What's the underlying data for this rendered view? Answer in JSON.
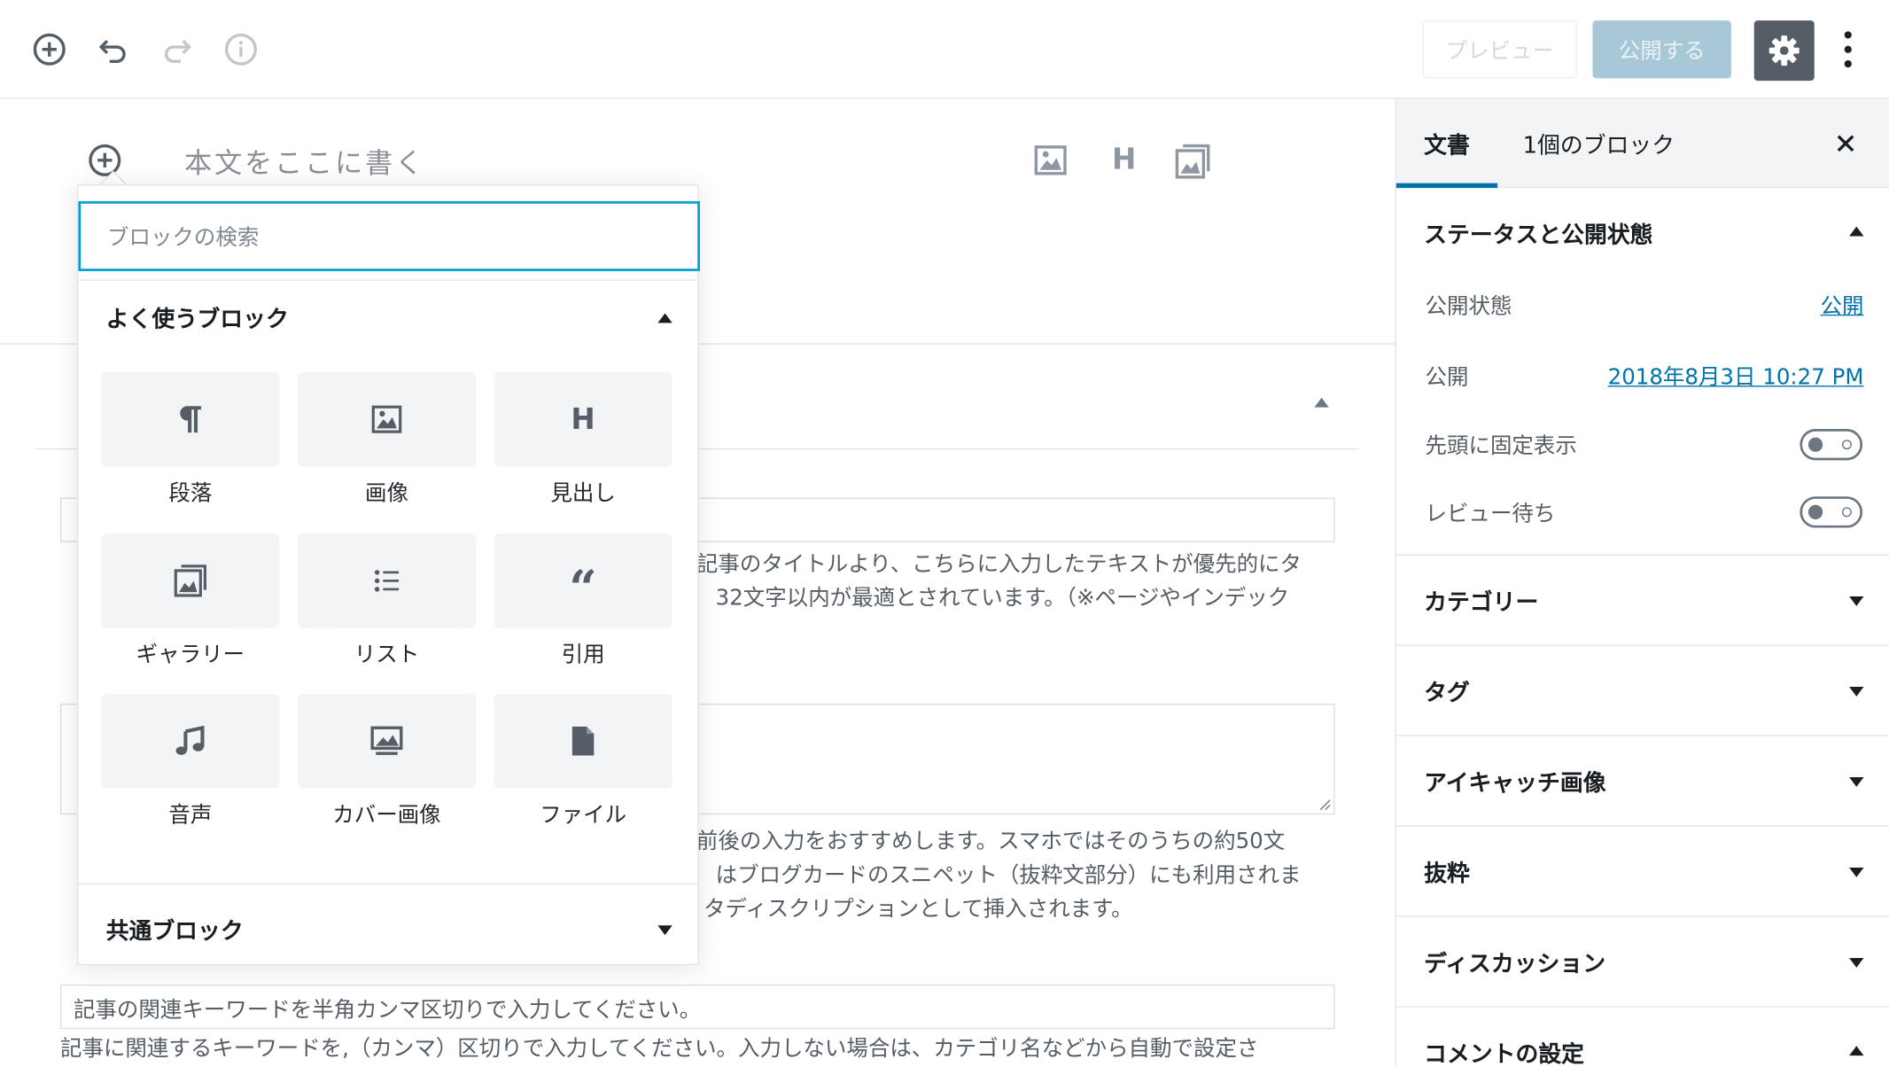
{
  "toolbar": {
    "add_icon": "plus-circle-icon",
    "undo_icon": "undo-icon",
    "redo_icon": "redo-icon",
    "info_icon": "info-icon",
    "preview_label": "プレビュー",
    "publish_label": "公開する",
    "settings_icon": "gear-icon",
    "more_icon": "more-vertical-icon"
  },
  "editor": {
    "placeholder": "本文をここに書く",
    "quick_icons": [
      "image-icon",
      "heading-icon",
      "gallery-icon"
    ]
  },
  "inserter": {
    "search_placeholder": "ブロックの検索",
    "common_title": "よく使うブロック",
    "blocks": [
      {
        "label": "段落",
        "icon": "paragraph-icon"
      },
      {
        "label": "画像",
        "icon": "image-icon"
      },
      {
        "label": "見出し",
        "icon": "heading-icon"
      },
      {
        "label": "ギャラリー",
        "icon": "gallery-icon"
      },
      {
        "label": "リスト",
        "icon": "list-icon"
      },
      {
        "label": "引用",
        "icon": "quote-icon"
      },
      {
        "label": "音声",
        "icon": "audio-icon"
      },
      {
        "label": "カバー画像",
        "icon": "cover-image-icon"
      },
      {
        "label": "ファイル",
        "icon": "file-icon"
      }
    ],
    "shared_title": "共通ブロック"
  },
  "meta": {
    "line1": "記事のタイトルより、こちらに入力したテキストが優先的にタ",
    "line2": "32文字以内が最適とされています。（※ページやインデック",
    "desc_line1": "前後の入力をおすすめします。スマホではそのうちの約50文",
    "desc_line2": "はブログカードのスニペット（抜粋文部分）にも利用されま",
    "desc_line3": "タディスクリプションとして挿入されます。",
    "keyword_placeholder": "記事の関連キーワードを半角カンマ区切りで入力してください。",
    "keyword_help": "記事に関連するキーワードを,（カンマ）区切りで入力してください。入力しない場合は、カテゴリ名などから自動で設定さ"
  },
  "sidebar": {
    "tab_document": "文書",
    "tab_block": "1個のブロック",
    "close_icon": "close-icon",
    "status_title": "ステータスと公開状態",
    "visibility_label": "公開状態",
    "visibility_value": "公開",
    "publish_label": "公開",
    "publish_date": "2018年8月3日 10:27 PM",
    "sticky_label": "先頭に固定表示",
    "pending_label": "レビュー待ち",
    "sticky_on": false,
    "pending_on": false,
    "sections": [
      "カテゴリー",
      "タグ",
      "アイキャッチ画像",
      "抜粋",
      "ディスカッション"
    ],
    "comment_title": "コメントの設定"
  },
  "colors": {
    "accent": "#0073aa",
    "focus": "#00a0d2",
    "publish_disabled": "#a8c8d8",
    "settings_active": "#555d66"
  }
}
